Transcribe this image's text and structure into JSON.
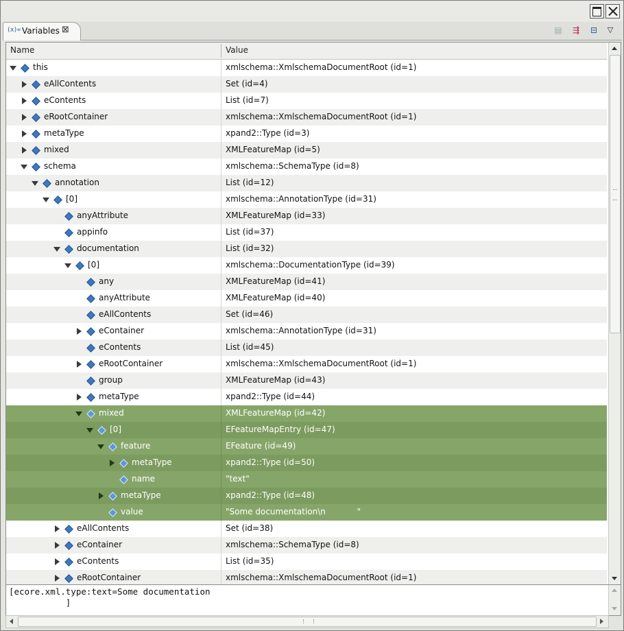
{
  "view": {
    "tab_icon": "(x)=",
    "tab_title": "Variables",
    "tab_close": "⊠"
  },
  "icons": {
    "collapse_all": "collapse-all-icon",
    "show_type_names": "show-type-names-icon",
    "toggle_detail_pane": "detail-pane-icon",
    "view_menu": "view-menu-icon",
    "maximize": "maximize-icon",
    "close": "close-icon",
    "variable": "variable-diamond-icon"
  },
  "colors": {
    "selection": "#7b9b5f",
    "variable_icon": "#3f78c0"
  },
  "columns": {
    "name": "Name",
    "value": "Value"
  },
  "rows": [
    {
      "name": "this",
      "value": "xmlschema::XmlschemaDocumentRoot (id=1)",
      "depth": 0,
      "toggle": "expanded",
      "selected": false
    },
    {
      "name": "eAllContents",
      "value": "Set (id=4)",
      "depth": 1,
      "toggle": "collapsed",
      "selected": false
    },
    {
      "name": "eContents",
      "value": "List (id=7)",
      "depth": 1,
      "toggle": "collapsed",
      "selected": false
    },
    {
      "name": "eRootContainer",
      "value": "xmlschema::XmlschemaDocumentRoot (id=1)",
      "depth": 1,
      "toggle": "collapsed",
      "selected": false
    },
    {
      "name": "metaType",
      "value": "xpand2::Type (id=3)",
      "depth": 1,
      "toggle": "collapsed",
      "selected": false
    },
    {
      "name": "mixed",
      "value": "XMLFeatureMap (id=5)",
      "depth": 1,
      "toggle": "collapsed",
      "selected": false
    },
    {
      "name": "schema",
      "value": "xmlschema::SchemaType (id=8)",
      "depth": 1,
      "toggle": "expanded",
      "selected": false
    },
    {
      "name": "annotation",
      "value": "List (id=12)",
      "depth": 2,
      "toggle": "expanded",
      "selected": false
    },
    {
      "name": "[0]",
      "value": "xmlschema::AnnotationType (id=31)",
      "depth": 3,
      "toggle": "expanded",
      "selected": false
    },
    {
      "name": "anyAttribute",
      "value": "XMLFeatureMap (id=33)",
      "depth": 4,
      "toggle": "none",
      "selected": false
    },
    {
      "name": "appinfo",
      "value": "List (id=37)",
      "depth": 4,
      "toggle": "none",
      "selected": false
    },
    {
      "name": "documentation",
      "value": "List (id=32)",
      "depth": 4,
      "toggle": "expanded",
      "selected": false
    },
    {
      "name": "[0]",
      "value": "xmlschema::DocumentationType (id=39)",
      "depth": 5,
      "toggle": "expanded",
      "selected": false
    },
    {
      "name": "any",
      "value": "XMLFeatureMap (id=41)",
      "depth": 6,
      "toggle": "none",
      "selected": false
    },
    {
      "name": "anyAttribute",
      "value": "XMLFeatureMap (id=40)",
      "depth": 6,
      "toggle": "none",
      "selected": false
    },
    {
      "name": "eAllContents",
      "value": "Set (id=46)",
      "depth": 6,
      "toggle": "none",
      "selected": false
    },
    {
      "name": "eContainer",
      "value": "xmlschema::AnnotationType (id=31)",
      "depth": 6,
      "toggle": "collapsed",
      "selected": false
    },
    {
      "name": "eContents",
      "value": "List (id=45)",
      "depth": 6,
      "toggle": "none",
      "selected": false
    },
    {
      "name": "eRootContainer",
      "value": "xmlschema::XmlschemaDocumentRoot (id=1)",
      "depth": 6,
      "toggle": "collapsed",
      "selected": false
    },
    {
      "name": "group",
      "value": "XMLFeatureMap (id=43)",
      "depth": 6,
      "toggle": "none",
      "selected": false
    },
    {
      "name": "metaType",
      "value": "xpand2::Type (id=44)",
      "depth": 6,
      "toggle": "collapsed",
      "selected": false
    },
    {
      "name": "mixed",
      "value": "XMLFeatureMap (id=42)",
      "depth": 6,
      "toggle": "expanded",
      "selected": true
    },
    {
      "name": "[0]",
      "value": "EFeatureMapEntry (id=47)",
      "depth": 7,
      "toggle": "expanded",
      "selected": true
    },
    {
      "name": "feature",
      "value": "EFeature (id=49)",
      "depth": 8,
      "toggle": "expanded",
      "selected": true
    },
    {
      "name": "metaType",
      "value": "xpand2::Type (id=50)",
      "depth": 9,
      "toggle": "collapsed",
      "selected": true
    },
    {
      "name": "name",
      "value": "\"text\"",
      "depth": 9,
      "toggle": "none",
      "selected": true
    },
    {
      "name": "metaType",
      "value": "xpand2::Type (id=48)",
      "depth": 8,
      "toggle": "collapsed",
      "selected": true
    },
    {
      "name": "value",
      "value": "\"Some documentation\\n            \"",
      "depth": 8,
      "toggle": "none",
      "selected": true
    },
    {
      "name": "eAllContents",
      "value": "Set (id=38)",
      "depth": 4,
      "toggle": "collapsed",
      "selected": false
    },
    {
      "name": "eContainer",
      "value": "xmlschema::SchemaType (id=8)",
      "depth": 4,
      "toggle": "collapsed",
      "selected": false
    },
    {
      "name": "eContents",
      "value": "List (id=35)",
      "depth": 4,
      "toggle": "collapsed",
      "selected": false
    },
    {
      "name": "eRootContainer",
      "value": "xmlschema::XmlschemaDocumentRoot (id=1)",
      "depth": 4,
      "toggle": "collapsed",
      "selected": false
    }
  ],
  "detail": {
    "text": "[ecore.xml.type:text=Some documentation\n           ]"
  }
}
